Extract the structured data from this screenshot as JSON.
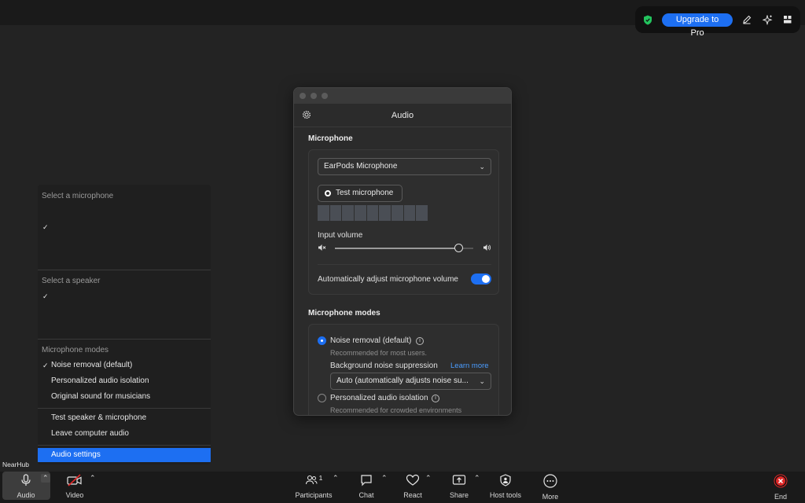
{
  "topbar": {
    "upgrade_label": "Upgrade to Pro",
    "icons": [
      "shield-icon",
      "pencil-icon",
      "sparkle-icon",
      "grid-icon"
    ]
  },
  "dialog": {
    "title": "Audio",
    "microphone_section": "Microphone",
    "microphone_select": "EarPods Microphone",
    "test_microphone": "Test microphone",
    "input_volume_label": "Input volume",
    "input_volume_level": 0.89,
    "auto_adjust_label": "Automatically adjust microphone volume",
    "auto_adjust_on": true,
    "modes_section": "Microphone modes",
    "noise_removal_label": "Noise removal (default)",
    "noise_removal_sub": "Recommended for most users.",
    "bg_noise_label": "Background noise suppression",
    "learn_more": "Learn more",
    "bg_noise_select": "Auto (automatically adjusts noise su...",
    "personalized_label": "Personalized audio isolation",
    "personalized_sub": "Recommended for crowded environments"
  },
  "menu": {
    "select_microphone": "Select a microphone",
    "select_speaker": "Select a speaker",
    "modes_header": "Microphone modes",
    "modes": [
      "Noise removal (default)",
      "Personalized audio isolation",
      "Original sound for musicians"
    ],
    "test": "Test speaker & microphone",
    "leave": "Leave computer audio",
    "settings": "Audio settings"
  },
  "nearhub": "NearHub",
  "toolbar": {
    "audio": "Audio",
    "video": "Video",
    "participants": "Participants",
    "participants_count": "1",
    "chat": "Chat",
    "react": "React",
    "share": "Share",
    "host_tools": "Host tools",
    "more": "More",
    "end": "End"
  },
  "colors": {
    "accent": "#1d6ff2",
    "end_red": "#e02828",
    "background": "#232323"
  }
}
